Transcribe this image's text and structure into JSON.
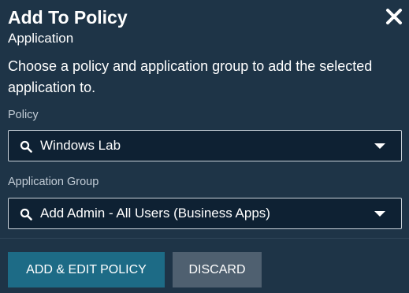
{
  "dialog": {
    "title": "Add To Policy",
    "subtitle": "Application",
    "description": "Choose a policy and application group to add the selected application to."
  },
  "policy": {
    "label": "Policy",
    "selected": "Windows Lab",
    "icon": "search-icon"
  },
  "application_group": {
    "label": "Application Group",
    "selected": "Add Admin - All Users (Business Apps)",
    "icon": "search-icon"
  },
  "actions": {
    "primary_label": "ADD & EDIT POLICY",
    "secondary_label": "DISCARD"
  },
  "colors": {
    "background": "#1e3447",
    "field_background": "#0e2133",
    "primary_button": "#1d6b86",
    "secondary_button": "#4f6070"
  }
}
